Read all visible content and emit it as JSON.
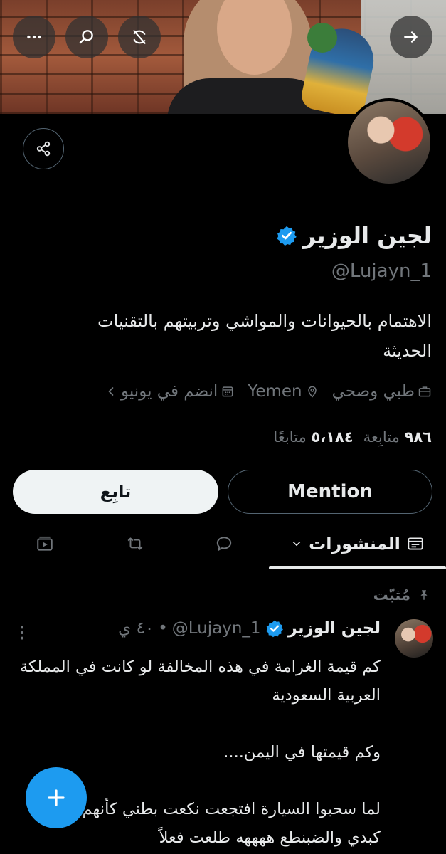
{
  "profile": {
    "name": "لجين الوزير",
    "handle": "@Lujayn_1",
    "bio": "الاهتمام بالحيوانات والمواشي وتربيتهم بالتقنيات الحديثة",
    "category": "طبي وصحي",
    "location": "Yemen",
    "joined": "انضم في يونيو",
    "following_count": "٩٨٦",
    "following_label": "متابِعة",
    "followers_count": "٥،١٨٤",
    "followers_label": "متابعًا"
  },
  "actions": {
    "mention_label": "Mention",
    "follow_label": "تابِع"
  },
  "tabs": {
    "posts_label": "المنشورات"
  },
  "pinned_tweet": {
    "pinned_label": "مُثبّت",
    "author_name": "لجين الوزير",
    "author_handle": "@Lujayn_1",
    "time": "٤٠ ي",
    "text": "كم قيمة الغرامة في هذه المخالفة لو كانت في المملكة العربية السعودية\n\nوكم قيمتها في اليمن....\n\nلما سحبوا السيارة افتجعت نكعت بطني كأنهم أخذوا كبدي والضبنطع ههههه طلعت فعلاً"
  },
  "colors": {
    "accent": "#1d9bf0",
    "background": "#000000",
    "muted_text": "#71767b",
    "primary_text": "#e7e9ea"
  }
}
